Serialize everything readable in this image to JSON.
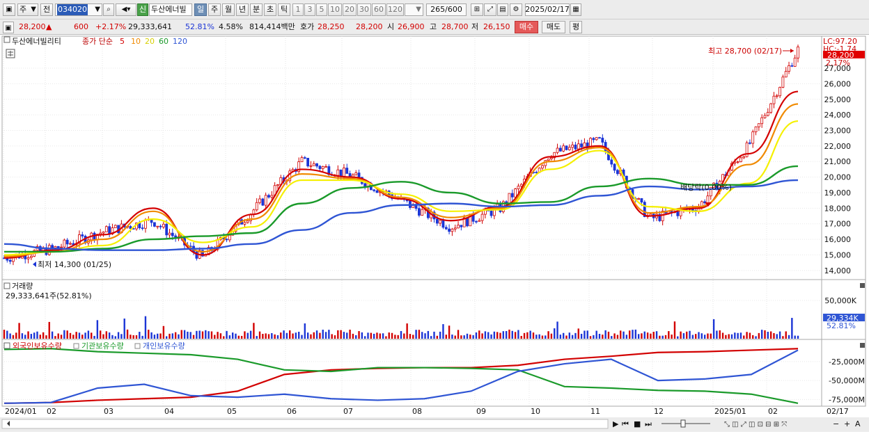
{
  "toolbar": {
    "market_type": "주",
    "prev_label": "전",
    "code": "034020",
    "stock_name": "두산에너빌",
    "credit_badge": "신",
    "periods": [
      "일",
      "주",
      "월",
      "년",
      "분",
      "초",
      "틱"
    ],
    "active_period": "일",
    "intervals": [
      "1",
      "3",
      "5",
      "10",
      "20",
      "30",
      "60",
      "120"
    ],
    "count": "265",
    "count_max": "600",
    "date": "2025/02/17"
  },
  "quote": {
    "price": "28,200",
    "change_arrow": "▲",
    "change": "600",
    "change_pct": "+2.17%",
    "volume": "29,333,641",
    "volume_ratio": "52.81%",
    "turnover": "4.58%",
    "amount": "814,414백만",
    "ask_label": "호가",
    "ask": "28,250",
    "bid": "28,200",
    "open_label": "시",
    "open": "26,900",
    "high_label": "고",
    "high": "28,700",
    "low_label": "저",
    "low": "26,150",
    "buy_label": "매수",
    "sell_label": "매도",
    "avg_label": "평"
  },
  "colors": {
    "up": "#d20000",
    "down": "#1b35d6",
    "ma5": "#d40000",
    "ma10": "#f08a00",
    "ma20": "#f5f000",
    "ma60": "#1a9a2a",
    "ma120": "#2f55d4"
  },
  "price_panel": {
    "stock_label": "두산에너빌리티",
    "legend_prefix": "종가 단순",
    "ma_labels": [
      "5",
      "10",
      "20",
      "60",
      "120"
    ],
    "high_annotation": "최고 28,700 (02/17)",
    "low_annotation": "최저 14,300 (01/25)",
    "dividend_annotation": "배당락(0.00%)",
    "lc_label": "LC:97.20",
    "hc_label": "HC:-1.74",
    "current_tag": "28,200",
    "current_pct": "2.17%",
    "yticks": [
      "27,000",
      "26,000",
      "25,000",
      "24,000",
      "23,000",
      "22,000",
      "21,000",
      "20,000",
      "19,000",
      "18,000",
      "17,000",
      "16,000",
      "15,000",
      "14,000"
    ]
  },
  "volume_panel": {
    "label": "거래량",
    "value_label": "29,333,641주(52.81%)",
    "ytick": "50,000K",
    "current_tag": "29,334K",
    "current_pct": "52.81%"
  },
  "holdings_panel": {
    "labels": [
      "외국인보유수량",
      "기관보유수량",
      "개인보유수량"
    ],
    "yticks": [
      "-25,000M",
      "-50,000M",
      "-75,000M"
    ]
  },
  "xaxis": {
    "labels": [
      "2024/01",
      "02",
      "03",
      "04",
      "05",
      "06",
      "07",
      "08",
      "09",
      "10",
      "11",
      "12",
      "2025/01",
      "02",
      "02/17"
    ]
  },
  "chart_data": [
    {
      "type": "candlestick",
      "title": "두산에너빌리티",
      "ylim": [
        13500,
        28700
      ],
      "x": [
        "2024/01",
        "02",
        "03",
        "04",
        "05",
        "06",
        "07",
        "08",
        "09",
        "10",
        "11",
        "12",
        "2025/01",
        "02",
        "02/17"
      ],
      "series": [
        {
          "name": "종가",
          "values": [
            14800,
            15400,
            16500,
            17200,
            14800,
            17800,
            21000,
            20100,
            18500,
            16800,
            18000,
            21500,
            22300,
            17300,
            18100,
            22000,
            28200
          ]
        },
        {
          "name": "5",
          "values": [
            14800,
            15300,
            16300,
            18000,
            15000,
            17600,
            20500,
            20000,
            18600,
            17200,
            18100,
            21300,
            22000,
            17500,
            18000,
            21500,
            25500
          ]
        },
        {
          "name": "10",
          "values": [
            14900,
            15200,
            16000,
            17800,
            15200,
            17300,
            20200,
            19900,
            18700,
            17400,
            18000,
            21000,
            21900,
            17700,
            18100,
            20800,
            24700
          ]
        },
        {
          "name": "20",
          "values": [
            15000,
            15200,
            15600,
            17300,
            15800,
            16800,
            19800,
            19800,
            18900,
            17800,
            17900,
            20500,
            21700,
            18100,
            17800,
            19600,
            23600
          ]
        },
        {
          "name": "60",
          "values": [
            15200,
            15200,
            15400,
            16000,
            16200,
            16400,
            18300,
            19300,
            19700,
            19000,
            18300,
            18400,
            19400,
            19900,
            19500,
            19500,
            20700
          ]
        },
        {
          "name": "120",
          "values": [
            15700,
            15400,
            15300,
            15300,
            15400,
            15700,
            16600,
            17700,
            18200,
            18300,
            18100,
            18200,
            18800,
            19400,
            19200,
            19400,
            19800
          ]
        }
      ],
      "annotations": {
        "high": 28700,
        "low": 14300
      }
    },
    {
      "type": "bar",
      "title": "거래량",
      "series": [
        {
          "name": "거래량",
          "values": [
            29333641
          ]
        }
      ],
      "ylim": [
        0,
        70000
      ]
    },
    {
      "type": "line",
      "title": "보유수량",
      "series": [
        {
          "name": "외국인보유수량",
          "values": [
            -80000,
            -79000,
            -76000,
            -74000,
            -72000,
            -64000,
            -42000,
            -36000,
            -34000,
            -33000,
            -33000,
            -30000,
            -22000,
            -18000,
            -13000,
            -12000,
            -10000,
            -8000
          ]
        },
        {
          "name": "기관보유수량",
          "values": [
            -9000,
            -8000,
            -12000,
            -14000,
            -16000,
            -22000,
            -36000,
            -38000,
            -33000,
            -33000,
            -34000,
            -36000,
            -58000,
            -60000,
            -63000,
            -64000,
            -68000,
            -80000
          ]
        },
        {
          "name": "개인보유수량",
          "values": [
            -80000,
            -79000,
            -60000,
            -55000,
            -70000,
            -72000,
            -68000,
            -74000,
            -76000,
            -74000,
            -64000,
            -38000,
            -28000,
            -22000,
            -50000,
            -48000,
            -42000,
            -10000
          ]
        }
      ],
      "ylim": [
        -82000,
        -5000
      ]
    }
  ]
}
